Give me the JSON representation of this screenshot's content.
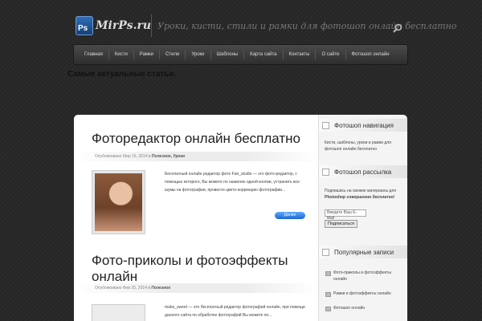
{
  "site": {
    "logo_badge": "Ps",
    "logo_text": "MirPs.ru",
    "tagline": "Уроки, кисти, стили и рамки для фотошоп онлайн бесплатно"
  },
  "nav": {
    "items": [
      "Главная",
      "Кисти",
      "Рамки",
      "Стили",
      "Уроки",
      "Шаблоны",
      "Карта сайта",
      "Контакты",
      "О сайте",
      "Фотошоп онлайн"
    ]
  },
  "section_heading": "Самые актуальные статьи.",
  "posts": [
    {
      "title": "Фоторедактор онлайн бесплатно",
      "meta_prefix": "Опубликовано Мар 16, 2014 в",
      "meta_categories": "Полезное, Уроки",
      "text": "Бесплатный онлайн редактор фото Fan_studio — это фото-редактор, с помощью которого, Вы можете по нажатию одной кнопки, устранить все шумы на фотографии, провести цвето-коррекцию фотографии...",
      "more_label": "Далее"
    },
    {
      "title": "Фото-приколы и фотоэффекты онлайн",
      "meta_prefix": "Опубликовано Фев 25, 2014 в",
      "meta_categories": "Полезное",
      "text": "make_sweet — это бесплатный редактор фотографий онлайн, при помощи данного сайта по обработке фотографий Вы можете по..."
    }
  ],
  "sidebar": {
    "nav_widget": {
      "title": "Фотошоп навигация",
      "text": "Кисти, шаблоны, уроки и рамки для фотошоп онлайн бесплатно"
    },
    "subscribe_widget": {
      "title": "Фотошоп рассылка",
      "text_prefix": "Подпишись на свежие материалы для",
      "text_bold": "Photoshop совершенно бесплатно!",
      "email_placeholder": "Введите Ваш E-Mail",
      "button_label": "Подписаться"
    },
    "popular_widget": {
      "title": "Популярные записи",
      "items": [
        "Фото-приколы и фотоэффекты онлайн",
        "Рамки и фотоэффекты онлайн",
        "Фотошоп онлайн"
      ]
    }
  },
  "colors": {
    "accent": "#1c66d0",
    "background": "#2b2b2b"
  }
}
